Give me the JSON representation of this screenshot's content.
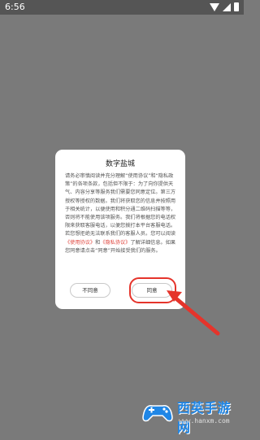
{
  "status_bar": {
    "time": "6:56"
  },
  "dialog": {
    "title": "数字盐城",
    "body_1": "请务必审慎阅读并充分理解“使用协议”和“隐私政策”的各项条款，包括但不限于：为了向你提供天气、内容分享等服务我们需要您同意定位。第三方授权等授权的数据。我们将获取您的信息并按照用于相关统计，以便使用和积分通二维码扫描等等，否则将不能使用该项服务。我们将根据您的电话权限来获取客服电话，以便您拨打本平台客服电话。若您想拒绝无法联系我们的客服人员。",
    "body_2_prefix": "您可以阅读",
    "link_terms": "《使用协议》",
    "body_2_and": "和",
    "link_privacy": "《隐私协议》",
    "body_2_suffix": "了解详细信息。如果您同意请点击“同意”开始接受我们的服务。",
    "decline_label": "不同意",
    "agree_label": "同意"
  },
  "watermark": {
    "name": "西英手游网",
    "url": "www.hanxm.com"
  },
  "colors": {
    "overlay": "#7a7a7a",
    "annotation_red": "#e5342b",
    "link_red": "#e0473f",
    "watermark_blue": "#1f86e6"
  }
}
